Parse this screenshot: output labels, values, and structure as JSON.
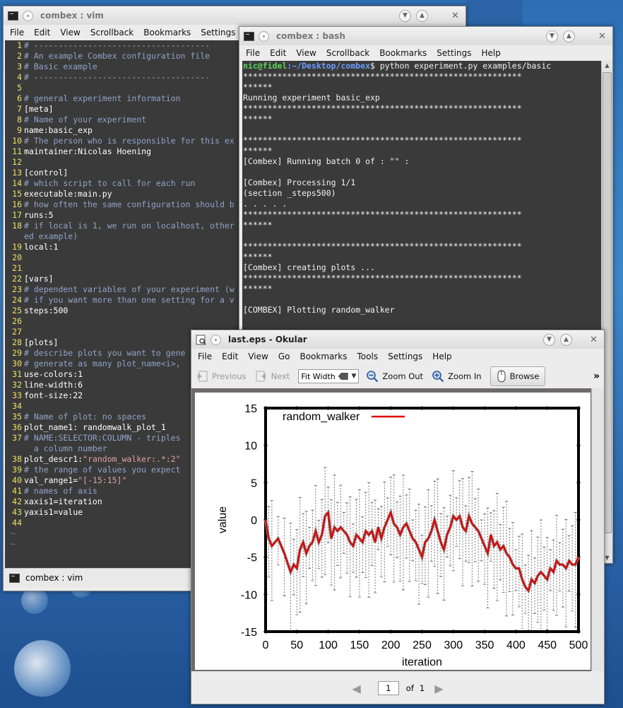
{
  "desktop": {
    "background": "#3577bd"
  },
  "vim_window": {
    "title": "combex : vim",
    "menu": [
      "File",
      "Edit",
      "View",
      "Scrollback",
      "Bookmarks",
      "Settings"
    ],
    "lines": [
      {
        "n": "1",
        "t": "# ------------------------------------",
        "k": "c"
      },
      {
        "n": "2",
        "t": "# An example Combex configuration file",
        "k": "c"
      },
      {
        "n": "3",
        "t": "# Basic example",
        "k": "c"
      },
      {
        "n": "4",
        "t": "# ------------------------------------",
        "k": "c"
      },
      {
        "n": "5",
        "t": "",
        "k": "p"
      },
      {
        "n": "6",
        "t": "# general experiment information",
        "k": "c"
      },
      {
        "n": "7",
        "t": "[meta]",
        "k": "p"
      },
      {
        "n": "8",
        "t": "# Name of your experiment",
        "k": "c"
      },
      {
        "n": "9",
        "t": "name:basic_exp",
        "k": "p"
      },
      {
        "n": "10",
        "t": "# The person who is responsible for this ex",
        "k": "c"
      },
      {
        "n": "11",
        "t": "maintainer:Nicolas Hoening",
        "k": "p"
      },
      {
        "n": "12",
        "t": "",
        "k": "p"
      },
      {
        "n": "13",
        "t": "[control]",
        "k": "p"
      },
      {
        "n": "14",
        "t": "# which script to call for each run",
        "k": "c"
      },
      {
        "n": "15",
        "t": "executable:main.py",
        "k": "p"
      },
      {
        "n": "16",
        "t": "# how often the same configuration should b",
        "k": "c"
      },
      {
        "n": "17",
        "t": "runs:5",
        "k": "p"
      },
      {
        "n": "18",
        "t": "# if local is 1, we run on localhost, other",
        "k": "c"
      },
      {
        "n": "",
        "t": "ed example)",
        "k": "c"
      },
      {
        "n": "19",
        "t": "local:1",
        "k": "p"
      },
      {
        "n": "20",
        "t": "",
        "k": "p"
      },
      {
        "n": "21",
        "t": "",
        "k": "p"
      },
      {
        "n": "22",
        "t": "[vars]",
        "k": "p"
      },
      {
        "n": "23",
        "t": "# dependent variables of your experiment (w",
        "k": "c"
      },
      {
        "n": "24",
        "t": "# if you want more than one setting for a v",
        "k": "c"
      },
      {
        "n": "25",
        "t": "steps:500",
        "k": "p"
      },
      {
        "n": "26",
        "t": "",
        "k": "p"
      },
      {
        "n": "27",
        "t": "",
        "k": "p"
      },
      {
        "n": "28",
        "t": "[plots]",
        "k": "p"
      },
      {
        "n": "29",
        "t": "# describe plots you want to gene",
        "k": "c"
      },
      {
        "n": "30",
        "t": "# generate as many plot_name<i>,",
        "k": "c"
      },
      {
        "n": "31",
        "t": "use-colors:1",
        "k": "p"
      },
      {
        "n": "32",
        "t": "line-width:6",
        "k": "p"
      },
      {
        "n": "33",
        "t": "font-size:22",
        "k": "p"
      },
      {
        "n": "34",
        "t": "",
        "k": "p"
      },
      {
        "n": "35",
        "t": "# Name of plot: no spaces",
        "k": "c"
      },
      {
        "n": "36",
        "t": "plot_name1: randomwalk_plot_1",
        "k": "p"
      },
      {
        "n": "37",
        "t": "# NAME:SELECTOR:COLUMN - triples",
        "k": "c"
      },
      {
        "n": "",
        "t": "  a column number",
        "k": "c"
      },
      {
        "n": "38",
        "t": "plot_descr1:",
        "s": "\"random_walker:.*:2\"",
        "k": "p"
      },
      {
        "n": "39",
        "t": "# the range of values you expect",
        "k": "c"
      },
      {
        "n": "40",
        "t": "val_range1=",
        "s": "\"[-15:15]\"",
        "k": "p"
      },
      {
        "n": "41",
        "t": "# names of axis",
        "k": "c"
      },
      {
        "n": "42",
        "t": "xaxis1=iteration",
        "k": "p"
      },
      {
        "n": "43",
        "t": "yaxis1=value",
        "k": "p"
      },
      {
        "n": "44",
        "t": "",
        "k": "p"
      },
      {
        "n": "",
        "t": "~",
        "k": "tilde"
      },
      {
        "n": "",
        "t": "~",
        "k": "tilde"
      }
    ],
    "status": "combex : vim"
  },
  "bash_window": {
    "title": "combex : bash",
    "menu": [
      "File",
      "Edit",
      "View",
      "Scrollback",
      "Bookmarks",
      "Settings",
      "Help"
    ],
    "prompt_user": "nic@fidel",
    "prompt_path": ":~/Desktop/combex",
    "prompt_cmd": "$ python experiment.py examples/basic",
    "lines": [
      "*********************************************************",
      "******",
      "Running experiment basic_exp",
      "*********************************************************",
      "******",
      "",
      "*********************************************************",
      "******",
      "[Combex] Running batch 0 of : \"\" :",
      "",
      "[Combex] Processing 1/1",
      "(section _steps500)",
      ". . . . .",
      "*********************************************************",
      "******",
      "",
      "*********************************************************",
      "******",
      "[Combex] creating plots ...",
      "*********************************************************",
      "******",
      "",
      "[COMBEX] Plotting random_walker"
    ]
  },
  "okular_window": {
    "title": "last.eps - Okular",
    "menu": [
      "File",
      "Edit",
      "View",
      "Go",
      "Bookmarks",
      "Tools",
      "Settings",
      "Help"
    ],
    "toolbar": {
      "previous": "Previous",
      "next": "Next",
      "fit": "Fit Width",
      "zoom_out": "Zoom Out",
      "zoom_in": "Zoom In",
      "browse": "Browse",
      "more": "»"
    },
    "page_nav": {
      "current": "1",
      "of_label": "of",
      "total": "1"
    }
  },
  "chart_data": {
    "type": "line",
    "title": "",
    "xlabel": "iteration",
    "ylabel": "value",
    "xlim": [
      0,
      500
    ],
    "ylim": [
      -15,
      15
    ],
    "xticks": [
      0,
      50,
      100,
      150,
      200,
      250,
      300,
      350,
      400,
      450,
      500
    ],
    "yticks": [
      15,
      10,
      5,
      0,
      -5,
      -10,
      -15
    ],
    "legend": "top-left",
    "series": [
      {
        "name": "random_walker",
        "color": "#e00000",
        "x": [
          0,
          5,
          10,
          20,
          30,
          40,
          45,
          50,
          55,
          60,
          65,
          70,
          75,
          80,
          85,
          90,
          95,
          100,
          105,
          110,
          115,
          120,
          125,
          130,
          135,
          140,
          145,
          150,
          155,
          160,
          165,
          170,
          175,
          180,
          185,
          190,
          195,
          200,
          205,
          210,
          215,
          220,
          225,
          230,
          235,
          240,
          245,
          250,
          255,
          260,
          265,
          270,
          275,
          280,
          285,
          290,
          295,
          300,
          305,
          310,
          315,
          320,
          325,
          330,
          335,
          340,
          345,
          350,
          355,
          360,
          365,
          370,
          375,
          380,
          385,
          390,
          395,
          400,
          405,
          410,
          415,
          420,
          425,
          430,
          435,
          440,
          445,
          450,
          455,
          460,
          465,
          470,
          475,
          480,
          485,
          490,
          495,
          500
        ],
        "y": [
          0,
          -2.5,
          -3.5,
          -2.5,
          -4.5,
          -7,
          -6,
          -6.5,
          -4,
          -3,
          -4.5,
          -3.5,
          -3,
          -1.5,
          -3,
          -2,
          0.5,
          1,
          -2.5,
          -1,
          -1.5,
          -1,
          -1.5,
          -2,
          -3,
          -3.5,
          -2,
          -2.5,
          -3,
          -1.5,
          -2,
          -1.5,
          -3,
          -1,
          -2.5,
          -1,
          0,
          1,
          -0.5,
          -1,
          -2,
          -1,
          -0.5,
          -1.5,
          -2.5,
          -3,
          -4,
          -5,
          -3,
          -2.5,
          -1.5,
          0,
          -1.5,
          -3,
          -4,
          -2,
          -1,
          0.5,
          0,
          0.5,
          -1,
          -1.5,
          0.5,
          -0.5,
          -1,
          -1.5,
          -2.5,
          -3.5,
          -4.5,
          -2,
          -3.5,
          -3,
          -4,
          -3.5,
          -4.5,
          -5,
          -6,
          -6.5,
          -6.5,
          -8,
          -9,
          -9.5,
          -8,
          -8.5,
          -7.5,
          -7,
          -7.5,
          -8,
          -6.5,
          -7,
          -5.5,
          -6,
          -6,
          -6.5,
          -5.5,
          -6,
          -6,
          -5
        ]
      }
    ]
  }
}
